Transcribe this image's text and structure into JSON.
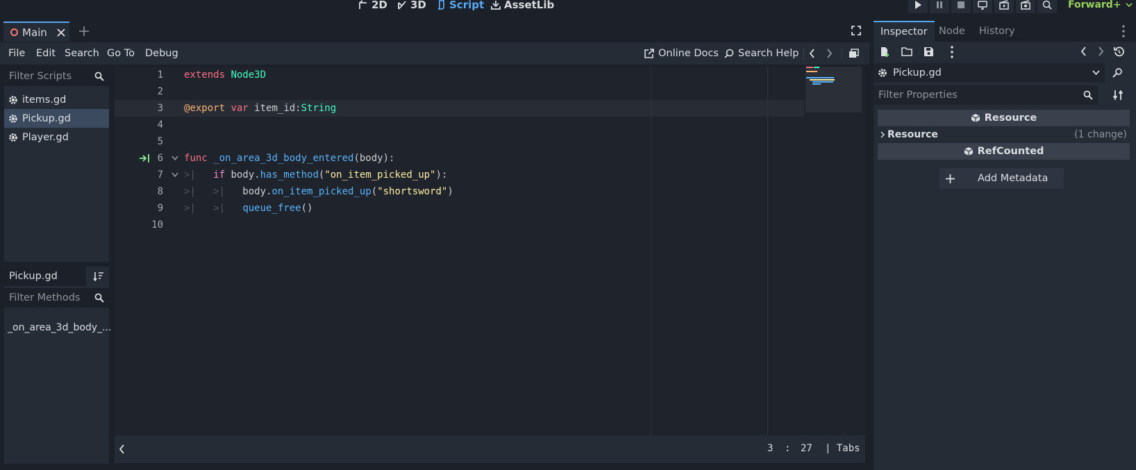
{
  "workspace": {
    "buttons": [
      "2D",
      "3D",
      "Script",
      "AssetLib"
    ],
    "active": "Script",
    "renderer": "Forward+"
  },
  "editor_tabs": {
    "main_label": "Main"
  },
  "menus": [
    "File",
    "Edit",
    "Search",
    "Go To",
    "Debug"
  ],
  "toolbar": {
    "online_docs": "Online Docs",
    "search_help": "Search Help"
  },
  "scripts": {
    "filter_placeholder": "Filter Scripts",
    "items": [
      "items.gd",
      "Pickup.gd",
      "Player.gd"
    ],
    "selected": "Pickup.gd"
  },
  "methods": {
    "current_script": "Pickup.gd",
    "filter_placeholder": "Filter Methods",
    "items": [
      "_on_area_3d_body_..."
    ]
  },
  "code": {
    "line_numbers": [
      "1",
      "2",
      "3",
      "4",
      "5",
      "6",
      "7",
      "8",
      "9",
      "10"
    ]
  },
  "status": {
    "line": "3",
    "separator": ":",
    "column": "27",
    "indent": "| Tabs"
  },
  "inspector": {
    "tabs": [
      "Inspector",
      "Node",
      "History"
    ],
    "active_tab": "Inspector",
    "resource_name": "Pickup.gd",
    "filter_placeholder": "Filter Properties",
    "section_resource": "Resource",
    "group_resource": "Resource",
    "group_resource_changes": "(1 change)",
    "section_refcounted": "RefCounted",
    "add_metadata": "Add Metadata"
  },
  "colors": {
    "accent": "#57a7f1",
    "background": "#1c2028",
    "panel": "#262c36",
    "editor_bg": "#1f232b",
    "keyword": "#ff7085",
    "type": "#42ffc2",
    "function": "#57b3ff",
    "string": "#ffeda1",
    "annotation": "#ffb373"
  }
}
